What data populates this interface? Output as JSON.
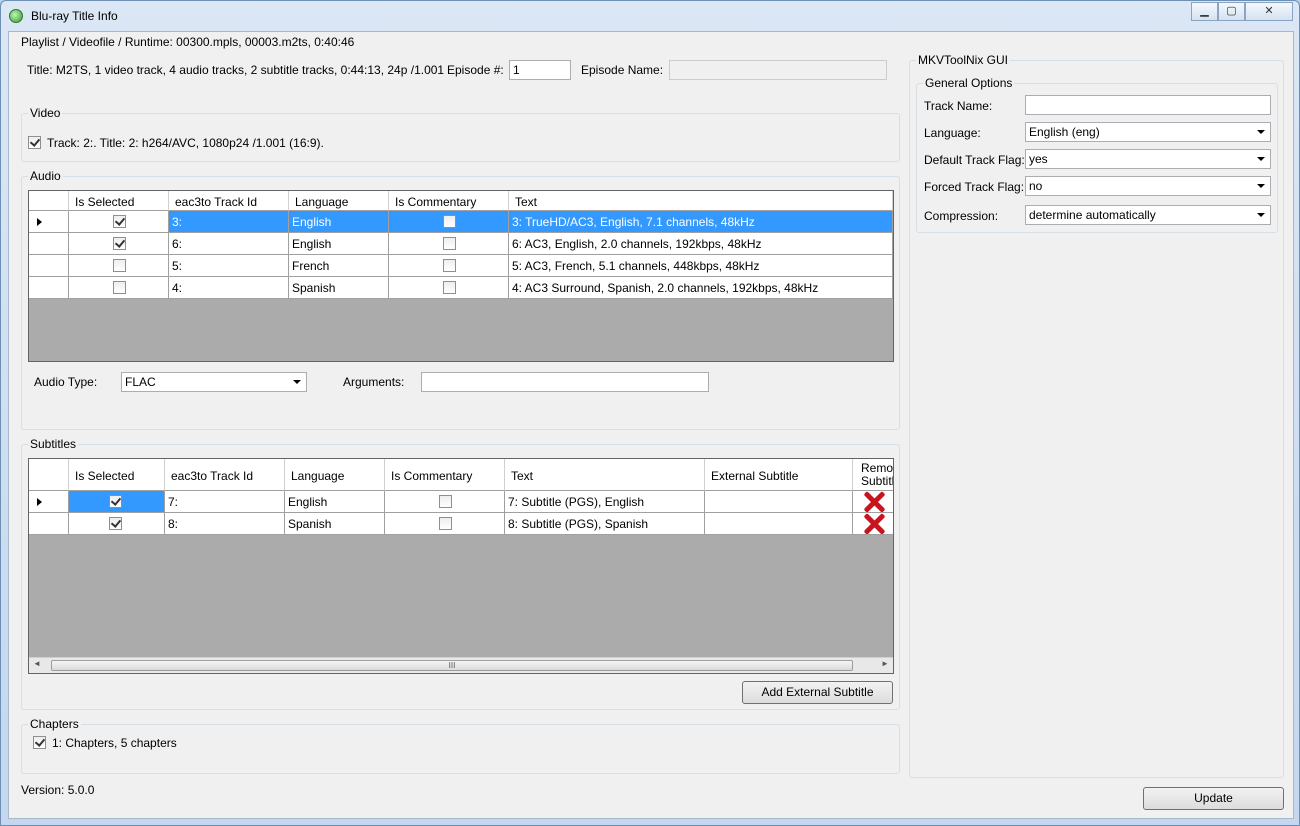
{
  "window": {
    "title": "Blu-ray Title Info",
    "minimize": "▁",
    "maximize": "▢",
    "close": "✕"
  },
  "playlist_label": "Playlist / Videofile / Runtime: 00300.mpls, 00003.m2ts, 0:40:46",
  "title_info": "Title: M2TS, 1 video track, 4 audio tracks, 2 subtitle tracks, 0:44:13, 24p /1.001",
  "episode": {
    "number_label": "Episode #:",
    "number_value": "1",
    "name_label": "Episode Name:",
    "name_value": ""
  },
  "video": {
    "group": "Video",
    "track_label": "Track: 2:. Title: 2: h264/AVC, 1080p24 /1.001 (16:9).",
    "checked": true
  },
  "audio": {
    "group": "Audio",
    "columns": [
      "Is Selected",
      "eac3to Track Id",
      "Language",
      "Is Commentary",
      "Text"
    ],
    "rows": [
      {
        "selected": true,
        "track_id": "3:",
        "language": "English",
        "commentary": false,
        "text": "3: TrueHD/AC3, English, 7.1 channels, 48kHz"
      },
      {
        "selected": true,
        "track_id": "6:",
        "language": "English",
        "commentary": false,
        "text": "6: AC3, English, 2.0 channels, 192kbps, 48kHz"
      },
      {
        "selected": false,
        "track_id": "5:",
        "language": "French",
        "commentary": false,
        "text": "5: AC3, French, 5.1 channels, 448kbps, 48kHz"
      },
      {
        "selected": false,
        "track_id": "4:",
        "language": "Spanish",
        "commentary": false,
        "text": "4: AC3 Surround, Spanish, 2.0 channels, 192kbps, 48kHz"
      }
    ],
    "type_label": "Audio Type:",
    "type_value": "FLAC",
    "arguments_label": "Arguments:",
    "arguments_value": ""
  },
  "subtitles": {
    "group": "Subtitles",
    "columns": [
      "Is Selected",
      "eac3to Track Id",
      "Language",
      "Is Commentary",
      "Text",
      "External Subtitle",
      "Remov Subtitle"
    ],
    "rows": [
      {
        "selected": true,
        "track_id": "7:",
        "language": "English",
        "commentary": false,
        "text": "7: Subtitle (PGS), English",
        "external": ""
      },
      {
        "selected": true,
        "track_id": "8:",
        "language": "Spanish",
        "commentary": false,
        "text": "8: Subtitle (PGS), Spanish",
        "external": ""
      }
    ],
    "scroll_grip": "III",
    "scroll_left": "◄",
    "scroll_right": "►",
    "add_button": "Add External Subtitle"
  },
  "chapters": {
    "group": "Chapters",
    "label": "1: Chapters, 5 chapters",
    "checked": true
  },
  "version": "Version: 5.0.0",
  "mkv": {
    "group": "MKVToolNix GUI",
    "general_group": "General Options",
    "track_name_label": "Track Name:",
    "track_name_value": "",
    "language_label": "Language:",
    "language_value": "English (eng)",
    "default_flag_label": "Default Track Flag:",
    "default_flag_value": "yes",
    "forced_flag_label": "Forced Track Flag:",
    "forced_flag_value": "no",
    "compression_label": "Compression:",
    "compression_value": "determine automatically"
  },
  "update_button": "Update",
  "colors": {
    "selection": "#3399ff",
    "grid_empty": "#ababab",
    "remove_icon": "#c8141e"
  }
}
